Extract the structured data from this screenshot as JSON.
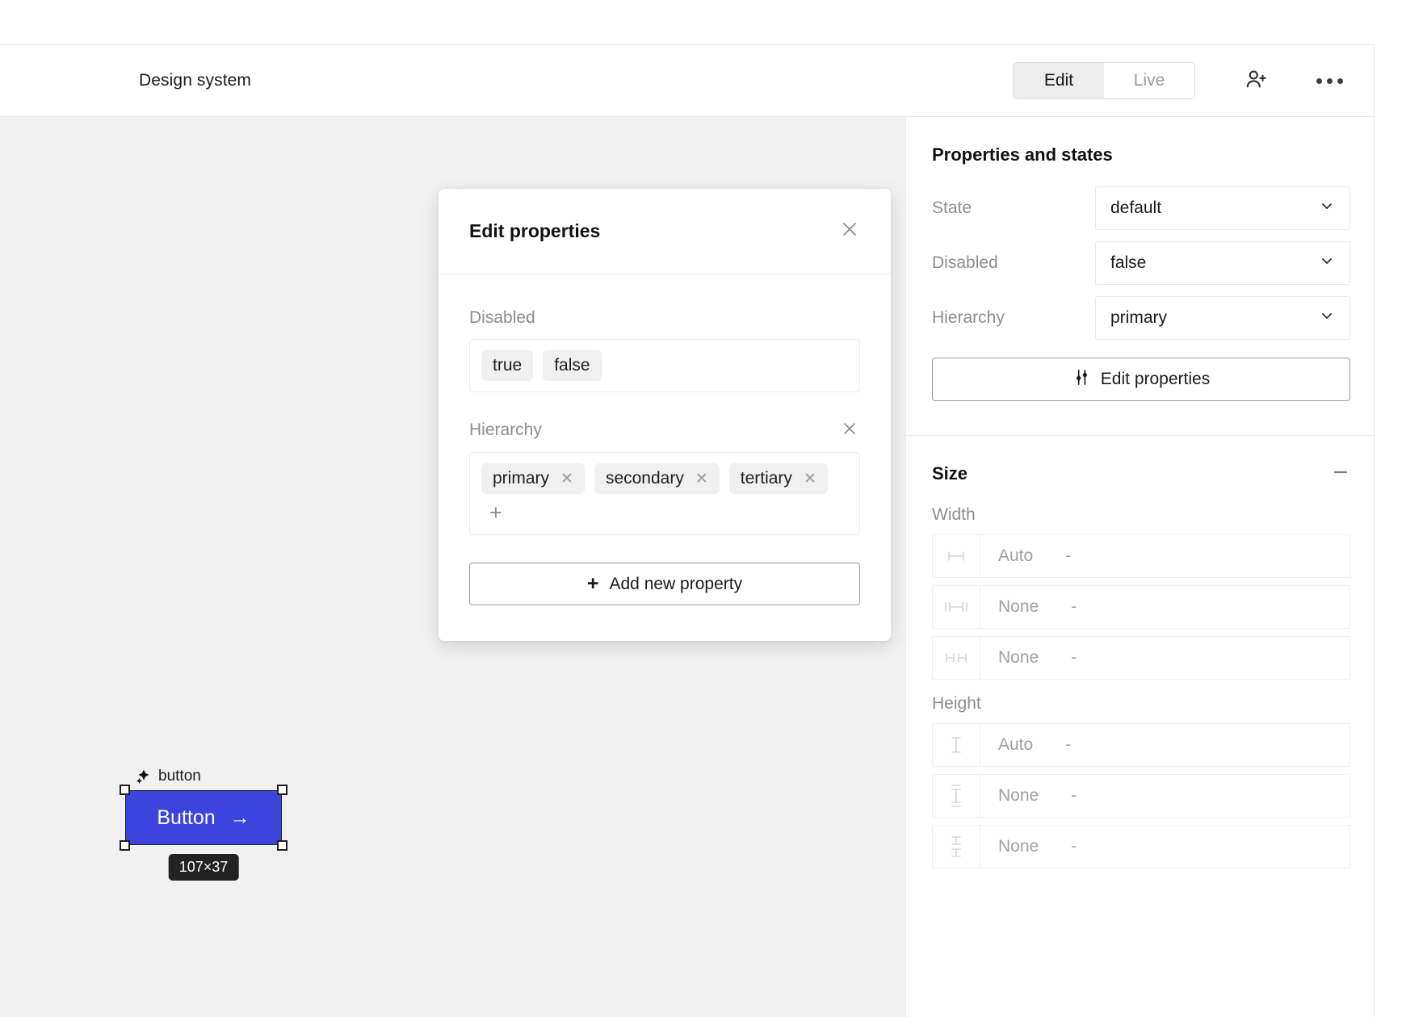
{
  "header": {
    "doc_title": "Design system",
    "mode_toggle": {
      "options": [
        {
          "label": "Edit",
          "active": true
        },
        {
          "label": "Live",
          "active": false
        }
      ]
    },
    "invite_icon": "person-add-icon",
    "more_icon": "more-horizontal-icon"
  },
  "canvas": {
    "node": {
      "label": "button",
      "icon": "component-sparkle-icon",
      "button_text": "Button",
      "button_arrow": "→",
      "size_badge": "107×37",
      "fill_color": "#3b44dd",
      "text_color": "#ffffff"
    }
  },
  "modal": {
    "title": "Edit properties",
    "close_icon": "close-icon",
    "properties": [
      {
        "name": "Disabled",
        "removable": false,
        "values": [
          {
            "label": "true",
            "removable": false
          },
          {
            "label": "false",
            "removable": false
          }
        ],
        "show_add": false
      },
      {
        "name": "Hierarchy",
        "removable": true,
        "values": [
          {
            "label": "primary",
            "removable": true
          },
          {
            "label": "secondary",
            "removable": true
          },
          {
            "label": "tertiary",
            "removable": true
          }
        ],
        "show_add": true,
        "add_glyph": "+"
      }
    ],
    "add_property_label": "Add new property",
    "add_property_glyph": "+"
  },
  "right_panel": {
    "properties_section": {
      "title": "Properties and states",
      "fields": [
        {
          "label": "State",
          "value": "default"
        },
        {
          "label": "Disabled",
          "value": "false"
        },
        {
          "label": "Hierarchy",
          "value": "primary"
        }
      ],
      "edit_button": {
        "label": "Edit properties",
        "icon": "sliders-vertical-icon"
      }
    },
    "size_section": {
      "title": "Size",
      "collapse_icon": "minus-icon",
      "width_label": "Width",
      "width_rows": [
        {
          "icon": "width-icon",
          "value": "Auto",
          "unit": "-"
        },
        {
          "icon": "min-width-icon",
          "value": "None",
          "unit": "-"
        },
        {
          "icon": "max-width-icon",
          "value": "None",
          "unit": "-"
        }
      ],
      "height_label": "Height",
      "height_rows": [
        {
          "icon": "height-icon",
          "value": "Auto",
          "unit": "-"
        },
        {
          "icon": "min-height-icon",
          "value": "None",
          "unit": "-"
        },
        {
          "icon": "max-height-icon",
          "value": "None",
          "unit": "-"
        }
      ]
    }
  }
}
